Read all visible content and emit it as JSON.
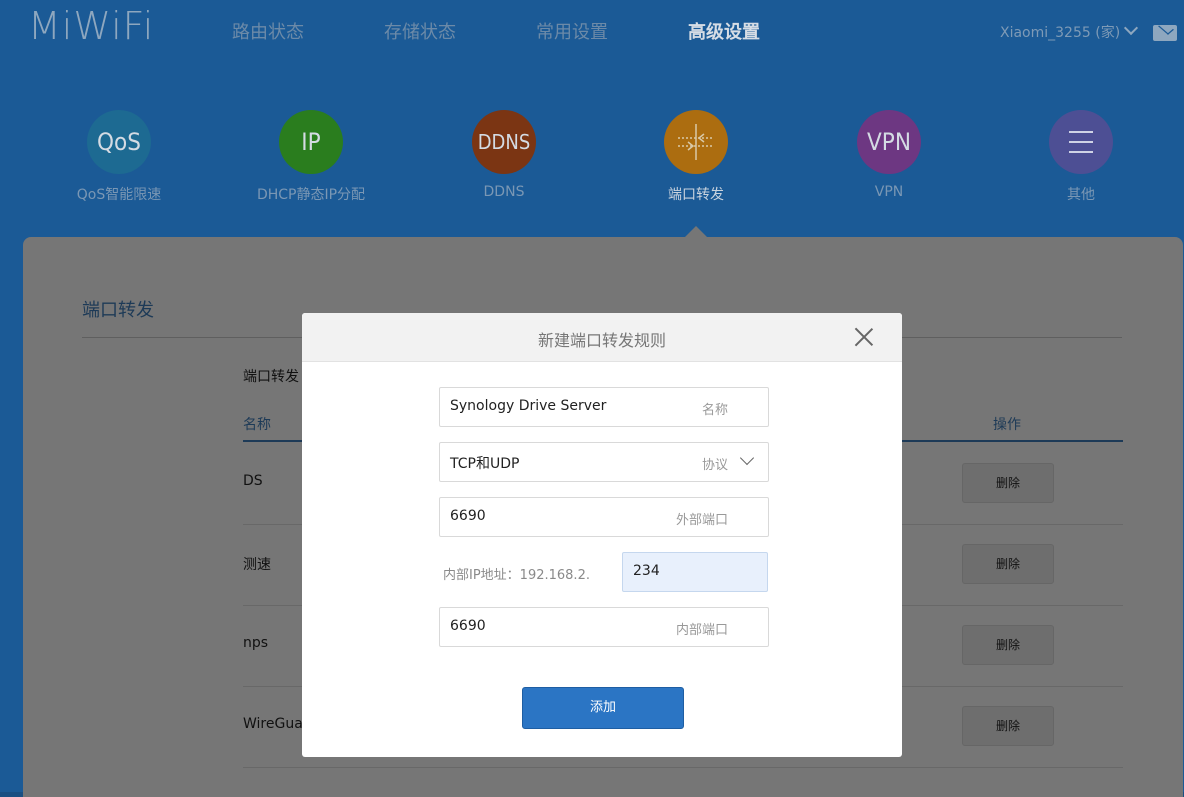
{
  "header": {
    "logo": "MiWiFi",
    "nav": [
      "路由状态",
      "存储状态",
      "常用设置",
      "高级设置"
    ],
    "user": "Xiaomi_3255 (家)"
  },
  "features": [
    {
      "icon_text": "QoS",
      "label": "QoS智能限速",
      "color": "#1d6a92"
    },
    {
      "icon_text": "IP",
      "label": "DHCP静态IP分配",
      "color": "#2a7d1e"
    },
    {
      "icon_text": "DDNS",
      "label": "DDNS",
      "color": "#7b3513"
    },
    {
      "icon_text": "",
      "label": "端口转发",
      "color": "#ac6d10"
    },
    {
      "icon_text": "VPN",
      "label": "VPN",
      "color": "#6d3782"
    },
    {
      "icon_text": "",
      "label": "其他",
      "color": "#4d4f94"
    }
  ],
  "panel": {
    "title": "端口转发",
    "subheading": "端口转发",
    "col_name": "名称",
    "col_action": "操作",
    "rows": [
      {
        "name": "DS",
        "action": "删除"
      },
      {
        "name": "测速",
        "action": "删除"
      },
      {
        "name": "nps",
        "action": "删除"
      },
      {
        "name": "WireGuar",
        "action": "删除"
      }
    ]
  },
  "modal": {
    "title": "新建端口转发规则",
    "name_value": "Synology Drive Server",
    "name_hint": "名称",
    "protocol_value": "TCP和UDP",
    "protocol_hint": "协议",
    "ext_port_value": "6690",
    "ext_port_hint": "外部端口",
    "ip_label": "内部IP地址：192.168.2.",
    "ip_value": "234",
    "int_port_value": "6690",
    "int_port_hint": "内部端口",
    "add_label": "添加"
  }
}
